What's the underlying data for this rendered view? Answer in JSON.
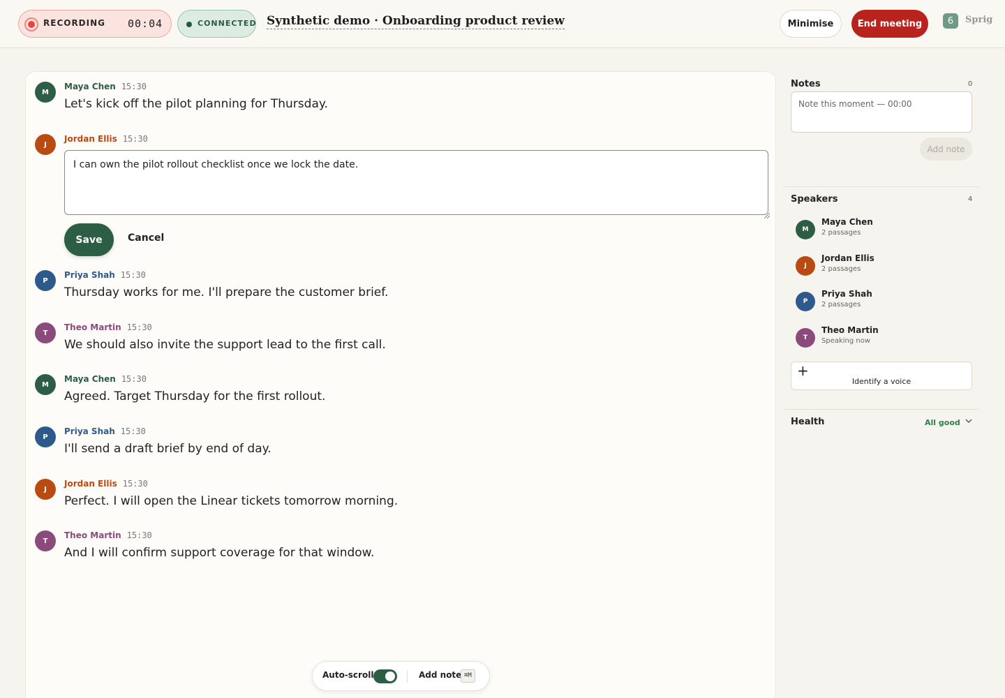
{
  "header": {
    "recording_label": "RECORDING",
    "recording_time": "00:04",
    "connection_label": "CONNECTED",
    "meeting_title": "Synthetic demo · Onboarding product review",
    "minimise_label": "Minimise",
    "end_meeting_label": "End meeting",
    "brand_name": "Sprig",
    "brand_glyph": "6"
  },
  "colors": {
    "maya": "#2d5e45",
    "jordan": "#b84a12",
    "priya": "#2d5a8a",
    "theo": "#8a4a7a",
    "end_button": "#b8231d",
    "save_button": "#2d5e45"
  },
  "transcript": [
    {
      "initial": "M",
      "speaker": "Maya Chen",
      "time": "15:30",
      "text": "Let's kick off the pilot planning for Thursday."
    },
    {
      "initial": "J",
      "speaker": "Jordan Ellis",
      "time": "15:30",
      "text": "I can own the pilot rollout checklist once we lock the date.",
      "editing": true
    },
    {
      "initial": "P",
      "speaker": "Priya Shah",
      "time": "15:30",
      "text": "Thursday works for me. I'll prepare the customer brief."
    },
    {
      "initial": "T",
      "speaker": "Theo Martin",
      "time": "15:30",
      "text": "We should also invite the support lead to the first call."
    },
    {
      "initial": "M",
      "speaker": "Maya Chen",
      "time": "15:30",
      "text": "Agreed. Target Thursday for the first rollout."
    },
    {
      "initial": "P",
      "speaker": "Priya Shah",
      "time": "15:30",
      "text": "I'll send a draft brief by end of day."
    },
    {
      "initial": "J",
      "speaker": "Jordan Ellis",
      "time": "15:30",
      "text": "Perfect. I will open the Linear tickets tomorrow morning."
    },
    {
      "initial": "T",
      "speaker": "Theo Martin",
      "time": "15:30",
      "text": "And I will confirm support coverage for that window."
    }
  ],
  "editor": {
    "save_label": "Save",
    "cancel_label": "Cancel"
  },
  "toolbar": {
    "autoscroll_label": "Auto-scroll",
    "autoscroll_on": true,
    "add_note_label": "Add note",
    "shortcut": "⌘M"
  },
  "notes": {
    "title": "Notes",
    "count": "0",
    "placeholder": "Note this moment — 00:00",
    "add_label": "Add note"
  },
  "speakers": {
    "title": "Speakers",
    "count": "4",
    "items": [
      {
        "initial": "M",
        "name": "Maya Chen",
        "sub": "2 passages"
      },
      {
        "initial": "J",
        "name": "Jordan Ellis",
        "sub": "2 passages"
      },
      {
        "initial": "P",
        "name": "Priya Shah",
        "sub": "2 passages"
      },
      {
        "initial": "T",
        "name": "Theo Martin",
        "sub": "Speaking now"
      }
    ],
    "identify_label": "Identify a voice"
  },
  "health": {
    "title": "Health",
    "status": "All good"
  }
}
